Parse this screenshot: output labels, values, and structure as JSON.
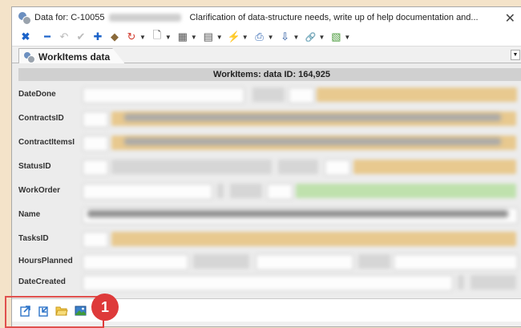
{
  "window": {
    "title_prefix": "Data for: C-10055",
    "title_description": "Clarification of data-structure needs, write up of help documentation and...",
    "close_glyph": "✕"
  },
  "toolbar": {
    "icons": [
      "delete-icon",
      "remove-icon",
      "undo-icon",
      "checkmark-icon",
      "add-icon",
      "eraser-icon",
      "refresh-icon",
      "new-document-icon",
      "table-icon",
      "form-icon",
      "action-icon",
      "print-icon",
      "download-icon",
      "link-icon",
      "map-icon"
    ],
    "glyphs": {
      "delete": "✖",
      "remove": "━",
      "undo": "↶",
      "check": "✔",
      "add": "✚",
      "erase": "◆",
      "refresh": "↻",
      "doc": "🗋",
      "table": "▦",
      "form": "▤",
      "action": "⚡",
      "print": "⎙",
      "download": "⇩",
      "link": "🔗",
      "map": "▧",
      "dropdown": "▼"
    }
  },
  "tab": {
    "label": "WorkItems data"
  },
  "section": {
    "header": "WorkItems: data ID: 164,925"
  },
  "fields": [
    {
      "label": "DateDone"
    },
    {
      "label": "ContractsID"
    },
    {
      "label": "ContractItemsI"
    },
    {
      "label": "StatusID"
    },
    {
      "label": "WorkOrder"
    },
    {
      "label": "Name"
    },
    {
      "label": "TasksID"
    },
    {
      "label": "HoursPlanned"
    },
    {
      "label": "DateCreated"
    }
  ],
  "bottom": {
    "icons": [
      "export-icon",
      "import-icon",
      "folder-open-icon",
      "image-icon"
    ],
    "badge": "1"
  },
  "colors": {
    "accent": "#1c63c9",
    "tan": "#e8c98f",
    "green": "#bfe1ad",
    "badge": "#de3a3a"
  }
}
